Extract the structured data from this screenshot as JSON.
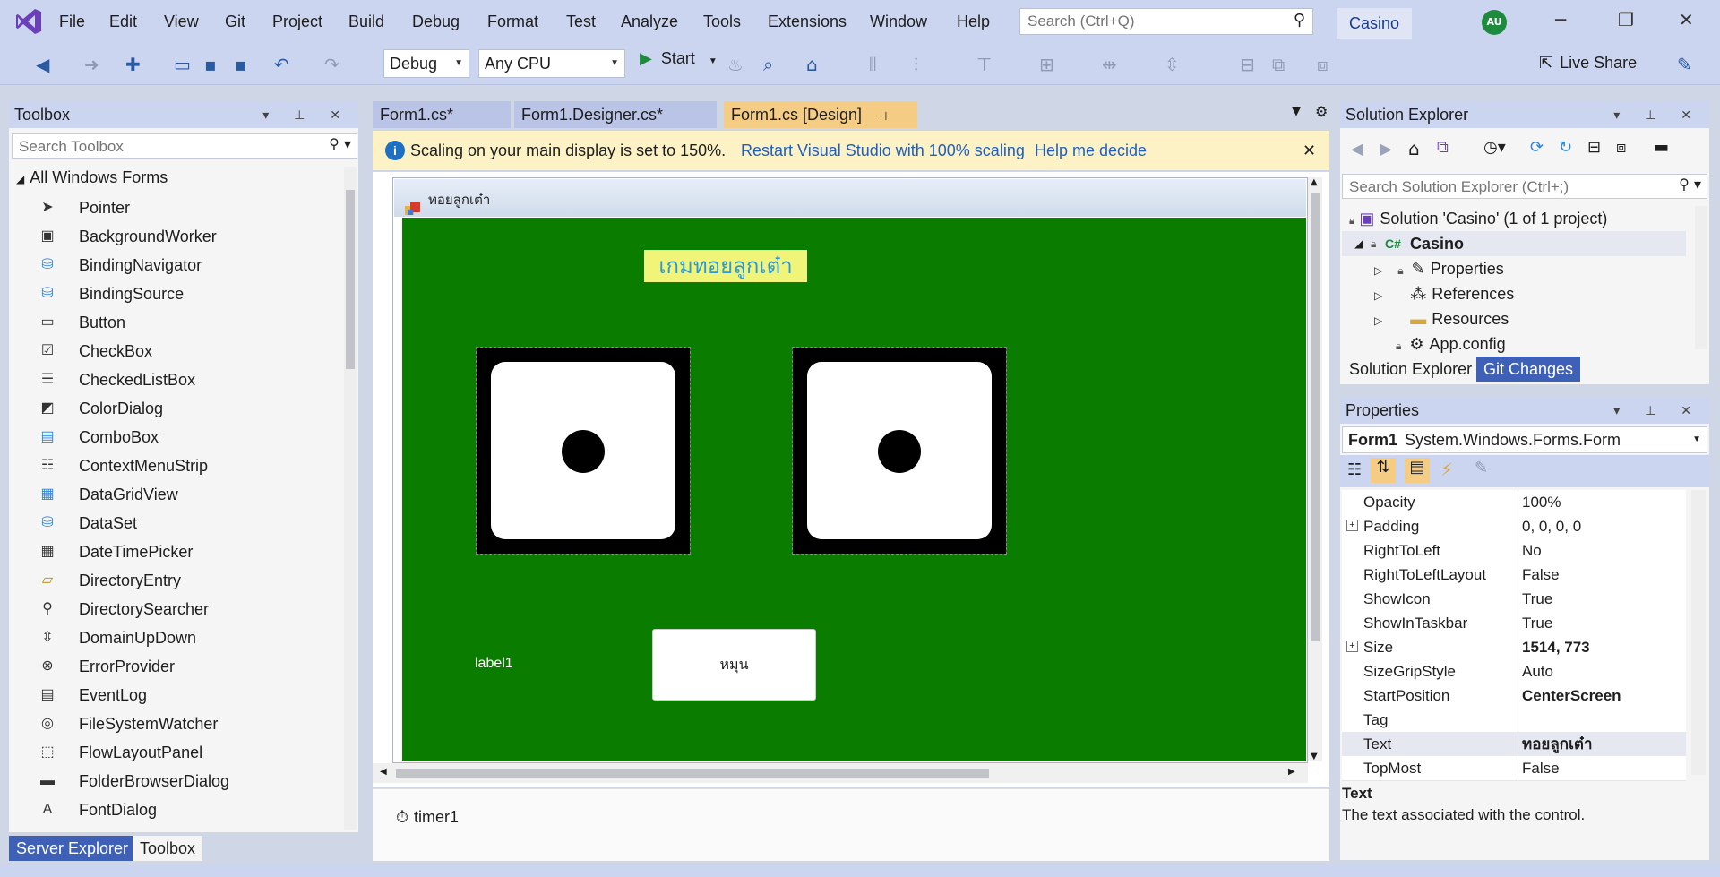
{
  "menu": [
    "File",
    "Edit",
    "View",
    "Git",
    "Project",
    "Build",
    "Debug",
    "Format",
    "Test",
    "Analyze",
    "Tools",
    "Extensions",
    "Window",
    "Help"
  ],
  "search": {
    "placeholder": "Search (Ctrl+Q)"
  },
  "solution_name": "Casino",
  "user_initials": "AU",
  "toolbar": {
    "config": "Debug",
    "platform": "Any CPU",
    "start_label": "Start",
    "live_share": "Live Share"
  },
  "toolbox": {
    "title": "Toolbox",
    "search_placeholder": "Search Toolbox",
    "group": "All Windows Forms",
    "items": [
      "Pointer",
      "BackgroundWorker",
      "BindingNavigator",
      "BindingSource",
      "Button",
      "CheckBox",
      "CheckedListBox",
      "ColorDialog",
      "ComboBox",
      "ContextMenuStrip",
      "DataGridView",
      "DataSet",
      "DateTimePicker",
      "DirectoryEntry",
      "DirectorySearcher",
      "DomainUpDown",
      "ErrorProvider",
      "EventLog",
      "FileSystemWatcher",
      "FlowLayoutPanel",
      "FolderBrowserDialog",
      "FontDialog"
    ],
    "bottom_tabs": [
      "Server Explorer",
      "Toolbox"
    ]
  },
  "doc_tabs": [
    "Form1.cs*",
    "Form1.Designer.cs*",
    "Form1.cs [Design]"
  ],
  "infobar": {
    "message": "Scaling on your main display is set to 150%.",
    "link1": "Restart Visual Studio with 100% scaling",
    "link2": "Help me decide"
  },
  "form": {
    "caption": "ทอยลูกเต๋า",
    "game_title": "เกมทอยลูกเต๋า",
    "label1": "label1",
    "button": "หมุน",
    "dice": [
      1,
      1
    ]
  },
  "tray": {
    "timer": "timer1"
  },
  "solution_explorer": {
    "title": "Solution Explorer",
    "search_placeholder": "Search Solution Explorer (Ctrl+;)",
    "nodes": [
      "Solution 'Casino' (1 of 1 project)",
      "Casino",
      "Properties",
      "References",
      "Resources",
      "App.config"
    ],
    "tabs": [
      "Solution Explorer",
      "Git Changes"
    ]
  },
  "properties": {
    "title": "Properties",
    "object_name": "Form1",
    "object_type": "System.Windows.Forms.Form",
    "rows": [
      {
        "name": "Opacity",
        "value": "100%"
      },
      {
        "name": "Padding",
        "value": "0, 0, 0, 0"
      },
      {
        "name": "RightToLeft",
        "value": "No"
      },
      {
        "name": "RightToLeftLayout",
        "value": "False"
      },
      {
        "name": "ShowIcon",
        "value": "True"
      },
      {
        "name": "ShowInTaskbar",
        "value": "True"
      },
      {
        "name": "Size",
        "value": "1514, 773"
      },
      {
        "name": "SizeGripStyle",
        "value": "Auto"
      },
      {
        "name": "StartPosition",
        "value": "CenterScreen"
      },
      {
        "name": "Tag",
        "value": ""
      },
      {
        "name": "Text",
        "value": "ทอยลูกเต๋า"
      },
      {
        "name": "TopMost",
        "value": "False"
      }
    ],
    "desc_title": "Text",
    "desc_text": "The text associated with the control."
  },
  "colors": {
    "chrome": "#ccd5f0",
    "form_green": "#0a7d00",
    "accent": "#1f6fc5",
    "active_tab": "#f5cc84"
  }
}
